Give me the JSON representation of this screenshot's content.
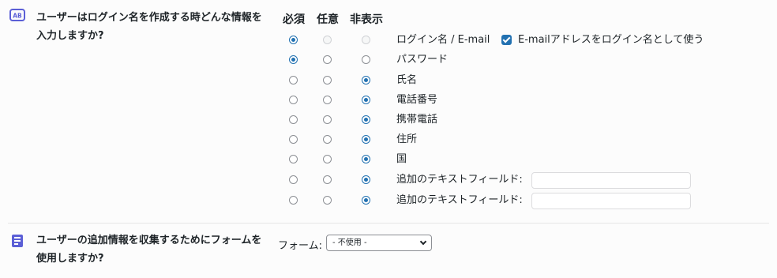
{
  "login_section": {
    "question": "ユーザーはログイン名を作成する時どんな情報を入力しますか?",
    "icon": "login-name-icon",
    "headers": [
      "必須",
      "任意",
      "非表示"
    ],
    "rows": [
      {
        "label": "ログイン名 / E-mail",
        "selected": "必須",
        "disabled_options": [
          "任意",
          "非表示"
        ]
      },
      {
        "label": "パスワード",
        "selected": "必須"
      },
      {
        "label": "氏名",
        "selected": "非表示"
      },
      {
        "label": "電話番号",
        "selected": "非表示"
      },
      {
        "label": "携帯電話",
        "selected": "非表示"
      },
      {
        "label": "住所",
        "selected": "非表示"
      },
      {
        "label": "国",
        "selected": "非表示"
      },
      {
        "label": "追加のテキストフィールド:",
        "selected": "非表示",
        "input_value": ""
      },
      {
        "label": "追加のテキストフィールド:",
        "selected": "非表示",
        "input_value": ""
      }
    ],
    "email_as_login": {
      "label": "E-mailアドレスをログイン名として使う",
      "checked": true
    }
  },
  "form_section": {
    "question": "ユーザーの追加情報を収集するためにフォームを使用しますか?",
    "icon": "form-icon",
    "form_label": "フォーム:",
    "form_select_value": "- 不使用 -"
  },
  "colors": {
    "accent": "#2271b1",
    "icon": "#5b5fd6"
  }
}
